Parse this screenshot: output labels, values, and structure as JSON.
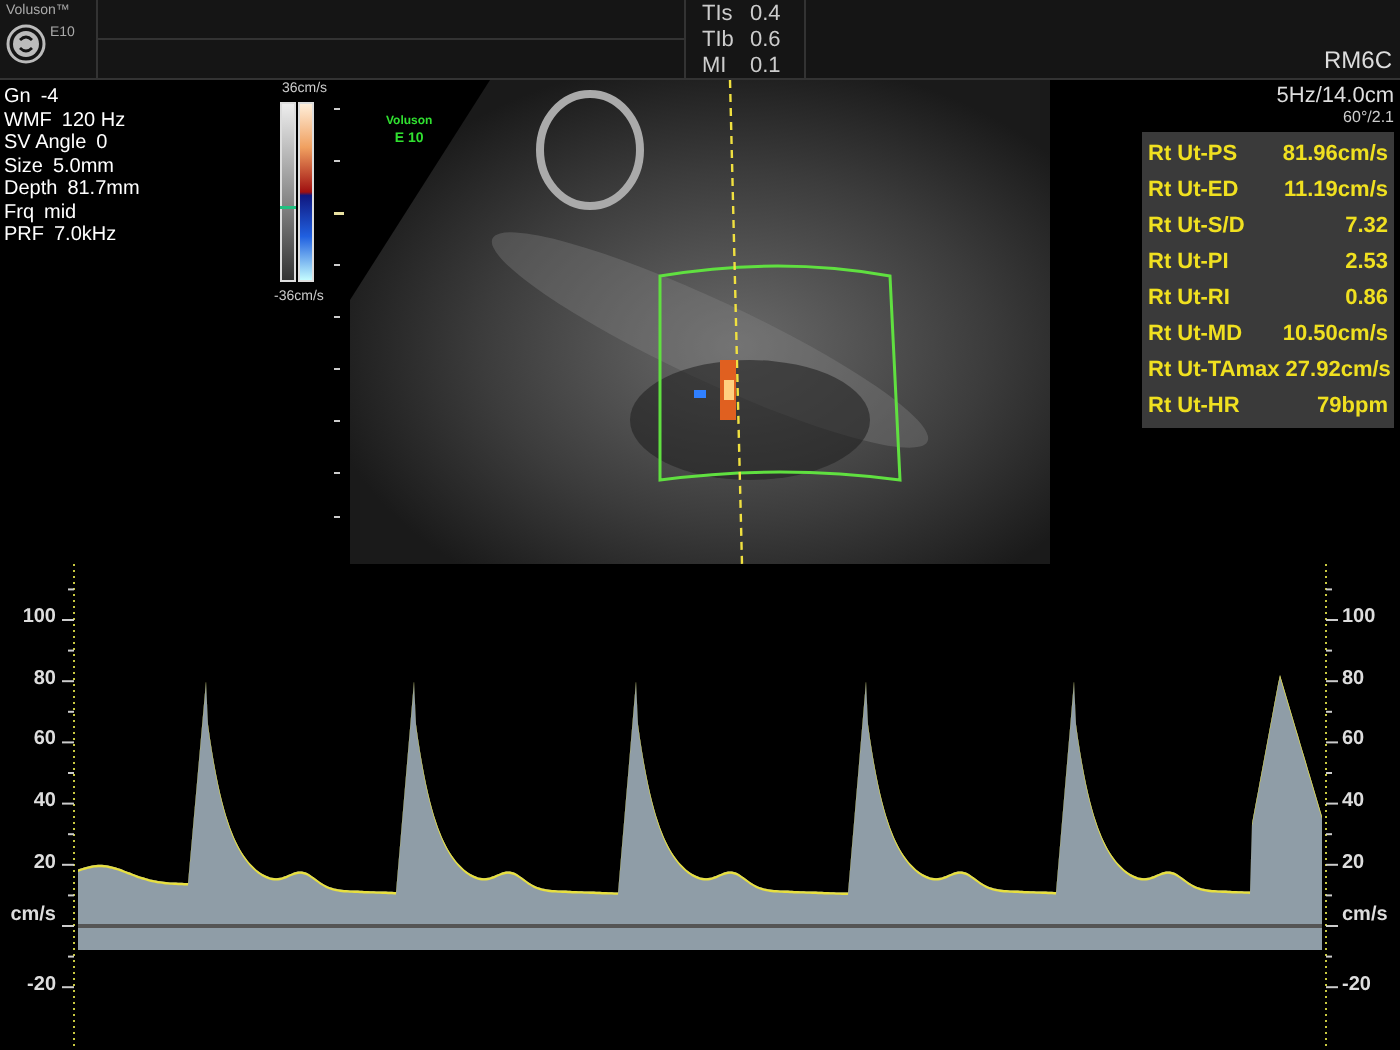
{
  "header": {
    "brand": "Voluson™",
    "model": "E10",
    "indices": [
      {
        "label": "TIs",
        "value": "0.4"
      },
      {
        "label": "TIb",
        "value": "0.6"
      },
      {
        "label": "MI",
        "value": "0.1"
      }
    ],
    "probe": "RM6C"
  },
  "parameters": [
    {
      "label": "Gn",
      "value": "-4"
    },
    {
      "label": "WMF",
      "value": "120 Hz"
    },
    {
      "label": "SV Angle",
      "value": "0"
    },
    {
      "label": "Size",
      "value": "5.0mm"
    },
    {
      "label": "Depth",
      "value": "81.7mm"
    },
    {
      "label": "Frq",
      "value": "mid"
    },
    {
      "label": "PRF",
      "value": "7.0kHz"
    }
  ],
  "color_scale": {
    "max": "36cm/s",
    "min": "-36cm/s"
  },
  "image_label": [
    "Voluson",
    "E 10"
  ],
  "scan_settings": [
    "5Hz/14.0cm",
    "60°/2.1"
  ],
  "measurements": [
    {
      "label": "Rt Ut-PS",
      "value": "81.96cm/s"
    },
    {
      "label": "Rt Ut-ED",
      "value": "11.19cm/s"
    },
    {
      "label": "Rt Ut-S/D",
      "value": "7.32"
    },
    {
      "label": "Rt Ut-PI",
      "value": "2.53"
    },
    {
      "label": "Rt Ut-RI",
      "value": "0.86"
    },
    {
      "label": "Rt Ut-MD",
      "value": "10.50cm/s"
    },
    {
      "label": "Rt Ut-TAmax",
      "value": "27.92cm/s"
    },
    {
      "label": "Rt Ut-HR",
      "value": "79bpm"
    }
  ],
  "spectrum": {
    "left_axis": [
      "100",
      "80",
      "60",
      "40",
      "20",
      "cm/s",
      "-20"
    ],
    "right_axis": [
      "100",
      "80",
      "60",
      "40",
      "20",
      "cm/s",
      "-20"
    ]
  }
}
